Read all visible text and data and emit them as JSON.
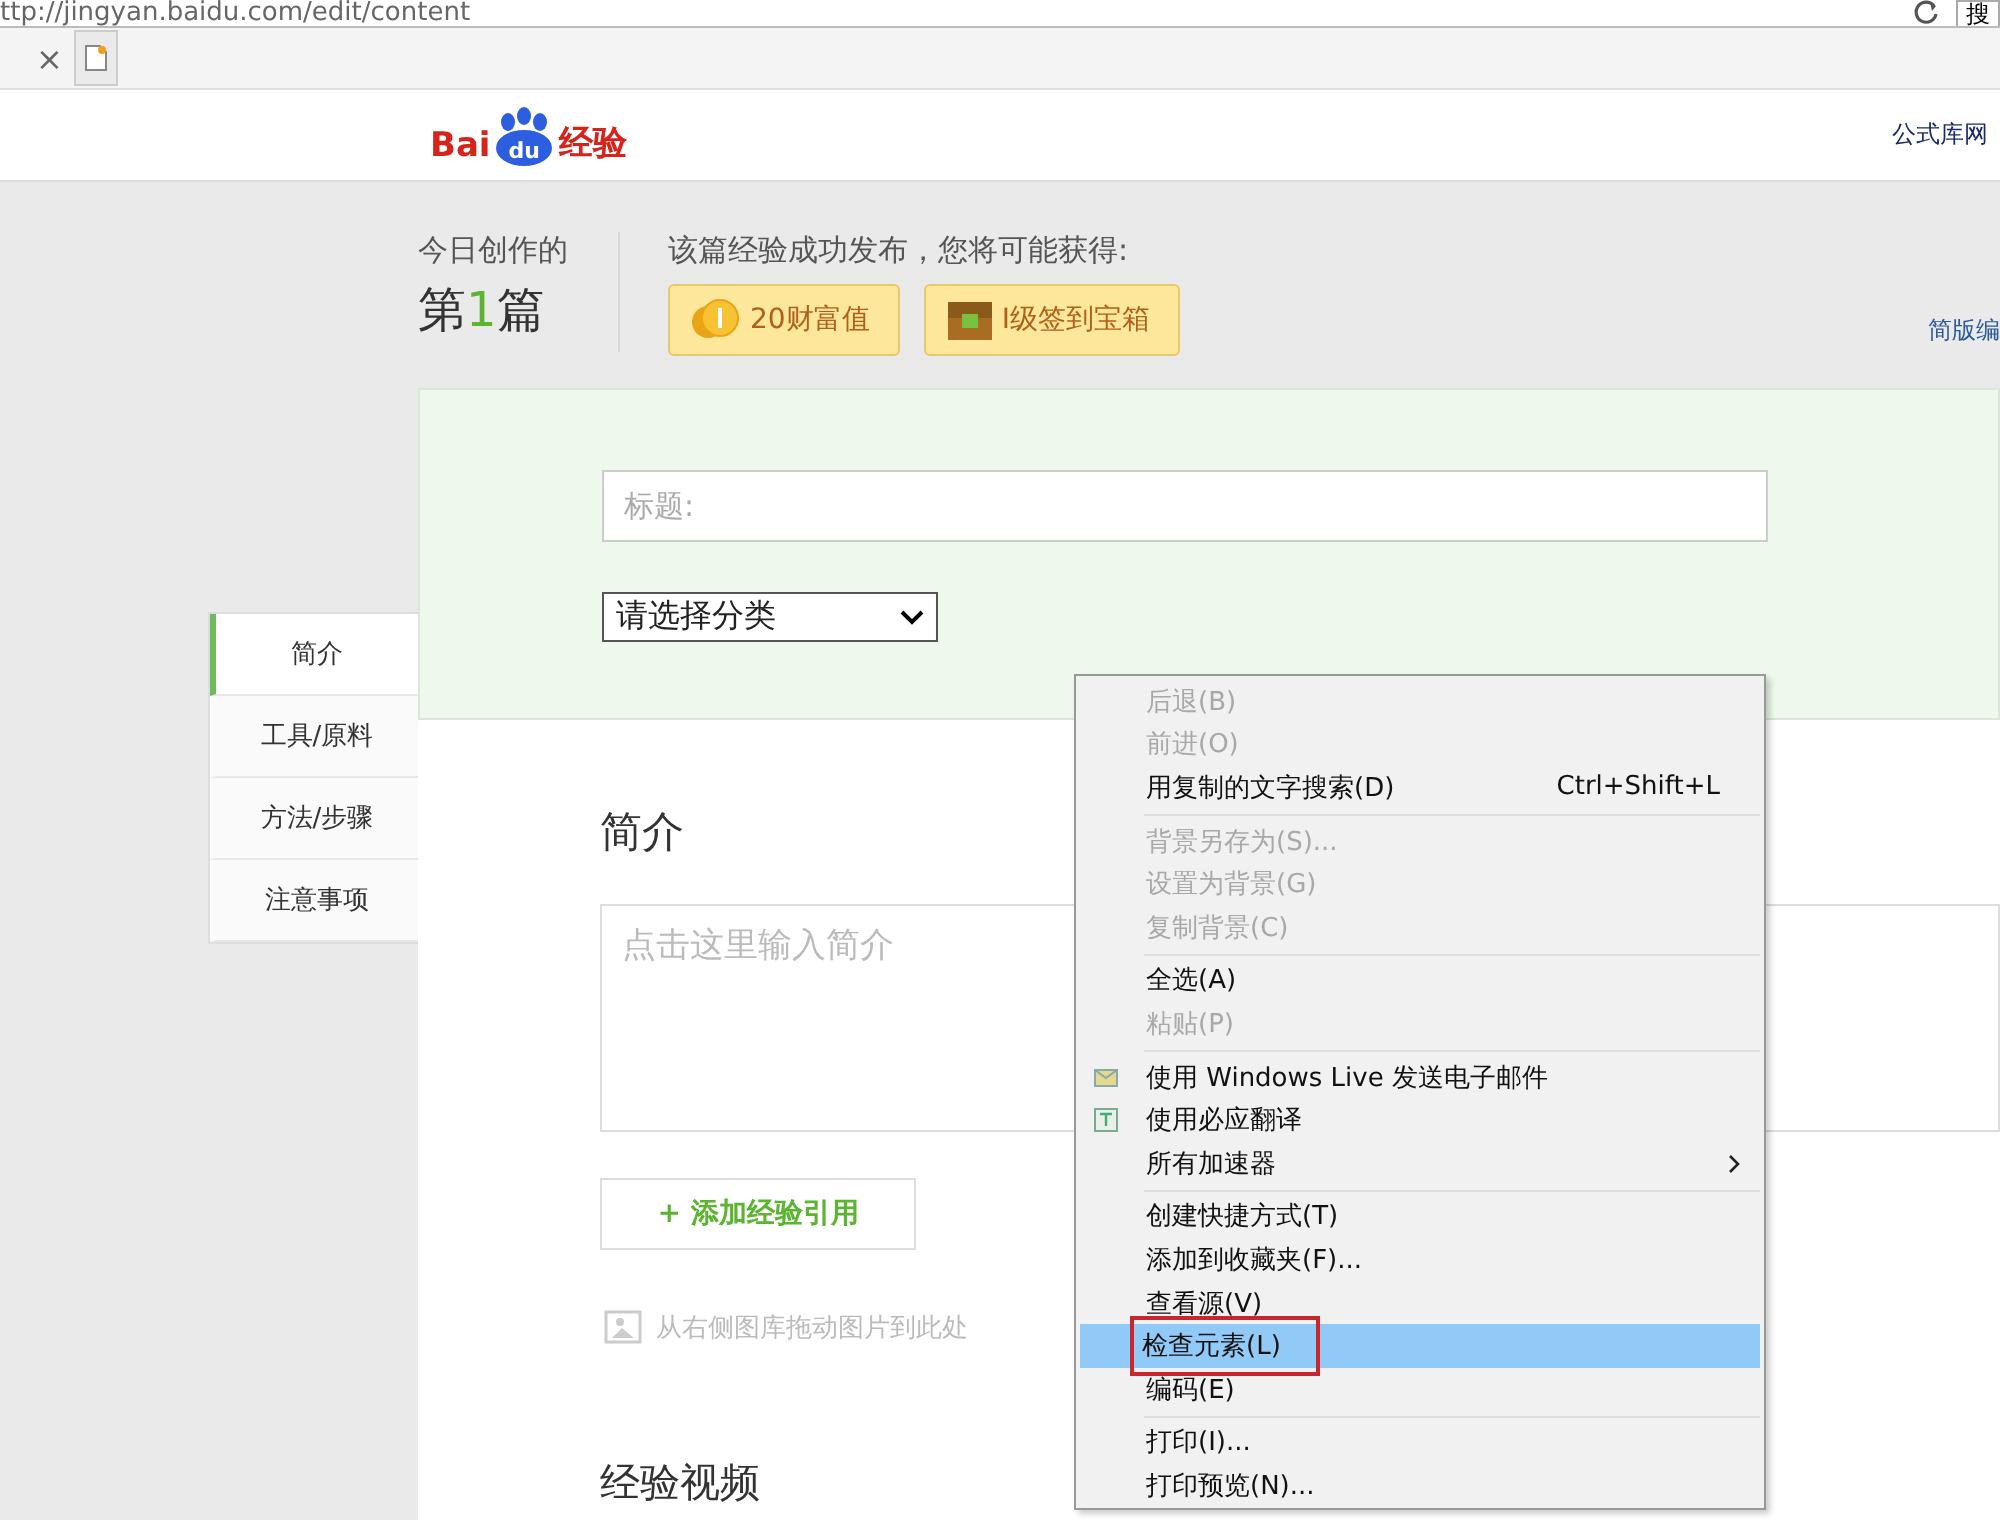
{
  "browser": {
    "address": "ttp://jingyan.baidu.com/edit/content",
    "tab_close": "×",
    "search_button": "搜"
  },
  "header": {
    "logo": {
      "part_1": "Bai",
      "part_2": "du",
      "part_3": "经验"
    },
    "link": "公式库网"
  },
  "today": {
    "label": "今日创作的",
    "count_prefix": "第",
    "count": "1",
    "count_suffix": "篇"
  },
  "rewards": {
    "title": "该篇经验成功发布，您将可能获得:",
    "items": [
      {
        "kind": "coins",
        "text": "20财富值"
      },
      {
        "kind": "chest",
        "text": "I级签到宝箱"
      }
    ]
  },
  "simple_link": "简版编",
  "form": {
    "title_placeholder": "标题:",
    "category": "请选择分类"
  },
  "nav": [
    {
      "label": "简介",
      "selected": true
    },
    {
      "label": "工具/原料",
      "selected": false
    },
    {
      "label": "方法/步骤",
      "selected": false
    },
    {
      "label": "注意事项",
      "selected": false
    }
  ],
  "intro": {
    "heading": "简介",
    "placeholder": "点击这里输入简介",
    "add_button": "+ 添加经验引用",
    "drop_hint": "从右侧图库拖动图片到此处",
    "video_heading": "经验视频"
  },
  "context_menu": [
    {
      "kind": "item",
      "label": "后退(B)",
      "disabled": true,
      "selected": false
    },
    {
      "kind": "item",
      "label": "前进(O)",
      "disabled": true,
      "selected": false
    },
    {
      "kind": "item",
      "label": "用复制的文字搜索(D)",
      "shortcut": "Ctrl+Shift+L",
      "disabled": false,
      "selected": false
    },
    {
      "kind": "separator"
    },
    {
      "kind": "item",
      "label": "背景另存为(S)...",
      "disabled": true,
      "selected": false
    },
    {
      "kind": "item",
      "label": "设置为背景(G)",
      "disabled": true,
      "selected": false
    },
    {
      "kind": "item",
      "label": "复制背景(C)",
      "disabled": true,
      "selected": false
    },
    {
      "kind": "separator"
    },
    {
      "kind": "item",
      "label": "全选(A)",
      "disabled": false,
      "selected": false
    },
    {
      "kind": "item",
      "label": "粘贴(P)",
      "disabled": true,
      "selected": false
    },
    {
      "kind": "separator"
    },
    {
      "kind": "mail",
      "label": "使用 Windows Live 发送电子邮件",
      "disabled": false,
      "selected": false
    },
    {
      "kind": "translate",
      "label": "使用必应翻译",
      "disabled": false,
      "selected": false
    },
    {
      "kind": "item",
      "label": "所有加速器",
      "submenu": true,
      "disabled": false,
      "selected": false
    },
    {
      "kind": "separator"
    },
    {
      "kind": "item",
      "label": "创建快捷方式(T)",
      "disabled": false,
      "selected": false
    },
    {
      "kind": "item",
      "label": "添加到收藏夹(F)...",
      "disabled": false,
      "selected": false
    },
    {
      "kind": "item",
      "label": "查看源(V)",
      "disabled": false,
      "selected": false
    },
    {
      "kind": "item",
      "label": "检查元素(L)",
      "disabled": false,
      "selected": true
    },
    {
      "kind": "item",
      "label": "编码(E)",
      "disabled": false,
      "selected": false
    },
    {
      "kind": "separator"
    },
    {
      "kind": "item",
      "label": "打印(I)...",
      "disabled": false,
      "selected": false
    },
    {
      "kind": "item",
      "label": "打印预览(N)...",
      "disabled": false,
      "selected": false
    }
  ]
}
